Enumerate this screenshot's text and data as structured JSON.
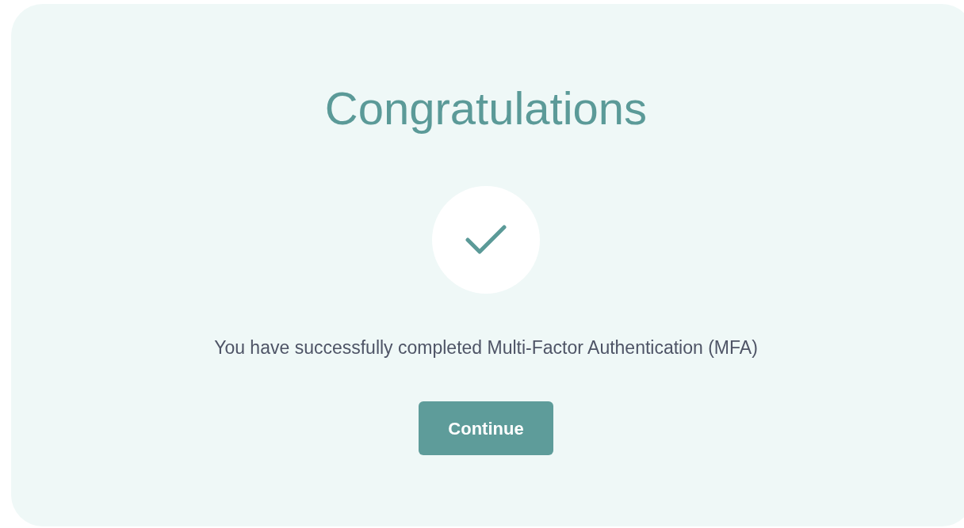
{
  "title": "Congratulations",
  "message": "You have successfully completed Multi-Factor Authentication (MFA)",
  "button": {
    "label": "Continue"
  }
}
